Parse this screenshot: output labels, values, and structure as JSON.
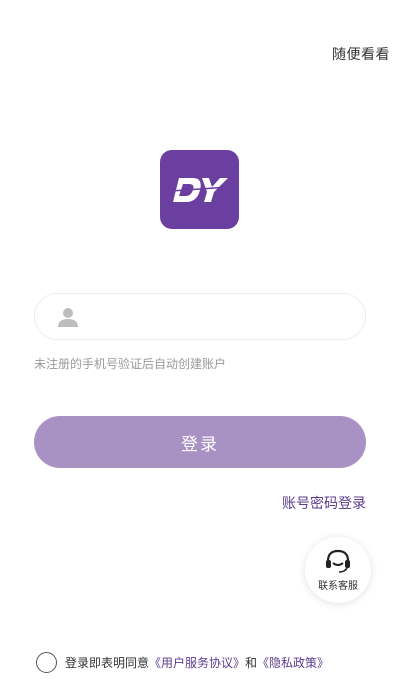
{
  "header": {
    "browse_label": "随便看看"
  },
  "logo": {
    "text": "DY",
    "color": "#6b3fa0"
  },
  "phone_input": {
    "value": "",
    "placeholder": ""
  },
  "hint_text": "未注册的手机号验证后自动创建账户",
  "login_button": {
    "label": "登录",
    "color": "#a892c4"
  },
  "password_login_label": "账号密码登录",
  "customer_service": {
    "label": "联系客服",
    "icon": "headset-icon"
  },
  "agreement": {
    "prefix": "登录即表明同意",
    "user_agreement": "《用户服务协议》",
    "conjunction": "和",
    "privacy_policy": "《隐私政策》"
  },
  "colors": {
    "accent": "#5b3c8c",
    "brand": "#6b3fa0"
  }
}
